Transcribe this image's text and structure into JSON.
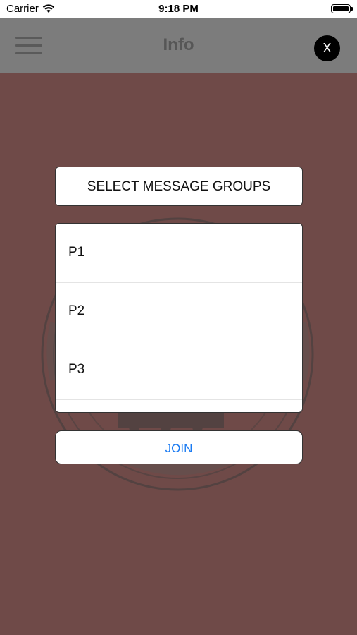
{
  "status_bar": {
    "carrier": "Carrier",
    "time": "9:18 PM"
  },
  "nav": {
    "title": "Info",
    "close_label": "X"
  },
  "dialog": {
    "header": "SELECT MESSAGE GROUPS",
    "groups": [
      {
        "label": "P1"
      },
      {
        "label": "P2"
      },
      {
        "label": "P3"
      },
      {
        "label": ""
      }
    ],
    "join_label": "JOIN"
  },
  "colors": {
    "background": "#6f4a48",
    "nav_bar": "#7c7c7c",
    "join_text": "#1b7bf2"
  },
  "icons": [
    "wifi-icon",
    "battery-icon",
    "menu-icon",
    "close-icon"
  ]
}
